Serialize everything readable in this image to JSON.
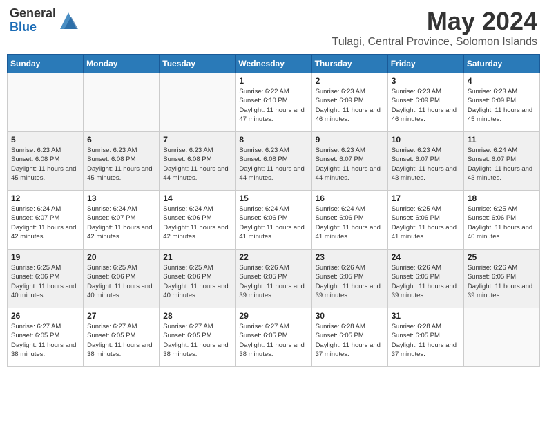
{
  "header": {
    "logo_general": "General",
    "logo_blue": "Blue",
    "month_year": "May 2024",
    "location": "Tulagi, Central Province, Solomon Islands"
  },
  "calendar": {
    "days_of_week": [
      "Sunday",
      "Monday",
      "Tuesday",
      "Wednesday",
      "Thursday",
      "Friday",
      "Saturday"
    ],
    "weeks": [
      [
        {
          "day": "",
          "info": ""
        },
        {
          "day": "",
          "info": ""
        },
        {
          "day": "",
          "info": ""
        },
        {
          "day": "1",
          "info": "Sunrise: 6:22 AM\nSunset: 6:10 PM\nDaylight: 11 hours and 47 minutes."
        },
        {
          "day": "2",
          "info": "Sunrise: 6:23 AM\nSunset: 6:09 PM\nDaylight: 11 hours and 46 minutes."
        },
        {
          "day": "3",
          "info": "Sunrise: 6:23 AM\nSunset: 6:09 PM\nDaylight: 11 hours and 46 minutes."
        },
        {
          "day": "4",
          "info": "Sunrise: 6:23 AM\nSunset: 6:09 PM\nDaylight: 11 hours and 45 minutes."
        }
      ],
      [
        {
          "day": "5",
          "info": "Sunrise: 6:23 AM\nSunset: 6:08 PM\nDaylight: 11 hours and 45 minutes."
        },
        {
          "day": "6",
          "info": "Sunrise: 6:23 AM\nSunset: 6:08 PM\nDaylight: 11 hours and 45 minutes."
        },
        {
          "day": "7",
          "info": "Sunrise: 6:23 AM\nSunset: 6:08 PM\nDaylight: 11 hours and 44 minutes."
        },
        {
          "day": "8",
          "info": "Sunrise: 6:23 AM\nSunset: 6:08 PM\nDaylight: 11 hours and 44 minutes."
        },
        {
          "day": "9",
          "info": "Sunrise: 6:23 AM\nSunset: 6:07 PM\nDaylight: 11 hours and 44 minutes."
        },
        {
          "day": "10",
          "info": "Sunrise: 6:23 AM\nSunset: 6:07 PM\nDaylight: 11 hours and 43 minutes."
        },
        {
          "day": "11",
          "info": "Sunrise: 6:24 AM\nSunset: 6:07 PM\nDaylight: 11 hours and 43 minutes."
        }
      ],
      [
        {
          "day": "12",
          "info": "Sunrise: 6:24 AM\nSunset: 6:07 PM\nDaylight: 11 hours and 42 minutes."
        },
        {
          "day": "13",
          "info": "Sunrise: 6:24 AM\nSunset: 6:07 PM\nDaylight: 11 hours and 42 minutes."
        },
        {
          "day": "14",
          "info": "Sunrise: 6:24 AM\nSunset: 6:06 PM\nDaylight: 11 hours and 42 minutes."
        },
        {
          "day": "15",
          "info": "Sunrise: 6:24 AM\nSunset: 6:06 PM\nDaylight: 11 hours and 41 minutes."
        },
        {
          "day": "16",
          "info": "Sunrise: 6:24 AM\nSunset: 6:06 PM\nDaylight: 11 hours and 41 minutes."
        },
        {
          "day": "17",
          "info": "Sunrise: 6:25 AM\nSunset: 6:06 PM\nDaylight: 11 hours and 41 minutes."
        },
        {
          "day": "18",
          "info": "Sunrise: 6:25 AM\nSunset: 6:06 PM\nDaylight: 11 hours and 40 minutes."
        }
      ],
      [
        {
          "day": "19",
          "info": "Sunrise: 6:25 AM\nSunset: 6:06 PM\nDaylight: 11 hours and 40 minutes."
        },
        {
          "day": "20",
          "info": "Sunrise: 6:25 AM\nSunset: 6:06 PM\nDaylight: 11 hours and 40 minutes."
        },
        {
          "day": "21",
          "info": "Sunrise: 6:25 AM\nSunset: 6:06 PM\nDaylight: 11 hours and 40 minutes."
        },
        {
          "day": "22",
          "info": "Sunrise: 6:26 AM\nSunset: 6:05 PM\nDaylight: 11 hours and 39 minutes."
        },
        {
          "day": "23",
          "info": "Sunrise: 6:26 AM\nSunset: 6:05 PM\nDaylight: 11 hours and 39 minutes."
        },
        {
          "day": "24",
          "info": "Sunrise: 6:26 AM\nSunset: 6:05 PM\nDaylight: 11 hours and 39 minutes."
        },
        {
          "day": "25",
          "info": "Sunrise: 6:26 AM\nSunset: 6:05 PM\nDaylight: 11 hours and 39 minutes."
        }
      ],
      [
        {
          "day": "26",
          "info": "Sunrise: 6:27 AM\nSunset: 6:05 PM\nDaylight: 11 hours and 38 minutes."
        },
        {
          "day": "27",
          "info": "Sunrise: 6:27 AM\nSunset: 6:05 PM\nDaylight: 11 hours and 38 minutes."
        },
        {
          "day": "28",
          "info": "Sunrise: 6:27 AM\nSunset: 6:05 PM\nDaylight: 11 hours and 38 minutes."
        },
        {
          "day": "29",
          "info": "Sunrise: 6:27 AM\nSunset: 6:05 PM\nDaylight: 11 hours and 38 minutes."
        },
        {
          "day": "30",
          "info": "Sunrise: 6:28 AM\nSunset: 6:05 PM\nDaylight: 11 hours and 37 minutes."
        },
        {
          "day": "31",
          "info": "Sunrise: 6:28 AM\nSunset: 6:05 PM\nDaylight: 11 hours and 37 minutes."
        },
        {
          "day": "",
          "info": ""
        }
      ]
    ]
  }
}
